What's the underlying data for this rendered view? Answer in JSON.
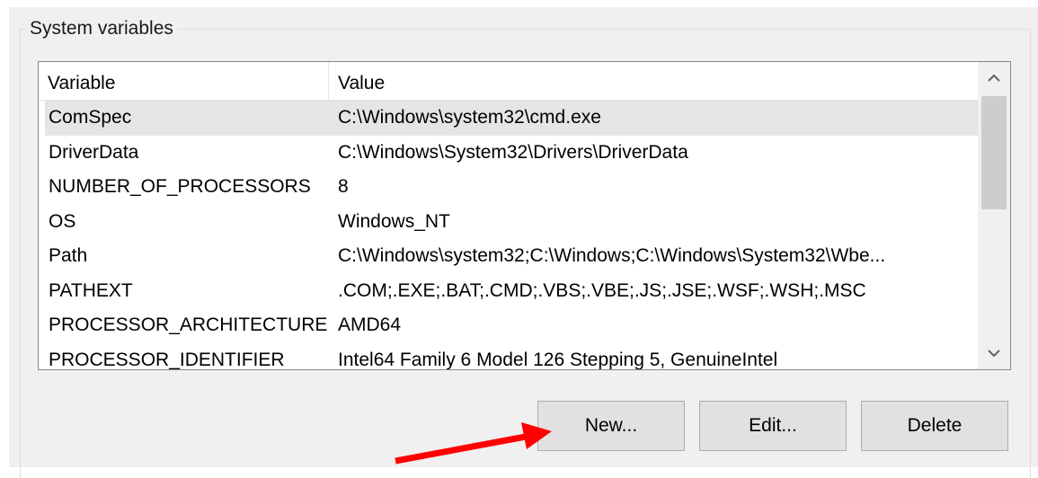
{
  "group_title": "System variables",
  "table": {
    "headers": {
      "variable": "Variable",
      "value": "Value"
    },
    "rows": [
      {
        "variable": "ComSpec",
        "value": "C:\\Windows\\system32\\cmd.exe"
      },
      {
        "variable": "DriverData",
        "value": "C:\\Windows\\System32\\Drivers\\DriverData"
      },
      {
        "variable": "NUMBER_OF_PROCESSORS",
        "value": "8"
      },
      {
        "variable": "OS",
        "value": "Windows_NT"
      },
      {
        "variable": "Path",
        "value": "C:\\Windows\\system32;C:\\Windows;C:\\Windows\\System32\\Wbe..."
      },
      {
        "variable": "PATHEXT",
        "value": ".COM;.EXE;.BAT;.CMD;.VBS;.VBE;.JS;.JSE;.WSF;.WSH;.MSC"
      },
      {
        "variable": "PROCESSOR_ARCHITECTURE",
        "value": "AMD64"
      },
      {
        "variable": "PROCESSOR_IDENTIFIER",
        "value": "Intel64 Family 6 Model 126 Stepping 5, GenuineIntel"
      }
    ],
    "selected_row": "ComSpec"
  },
  "scrollbar": {
    "up_icon": "chevron-up-icon",
    "down_icon": "chevron-down-icon"
  },
  "buttons": {
    "new": "New...",
    "edit": "Edit...",
    "delete": "Delete"
  },
  "annotation": {
    "icon": "red-arrow-icon",
    "color": "#ff0000",
    "points_to": "New..."
  }
}
